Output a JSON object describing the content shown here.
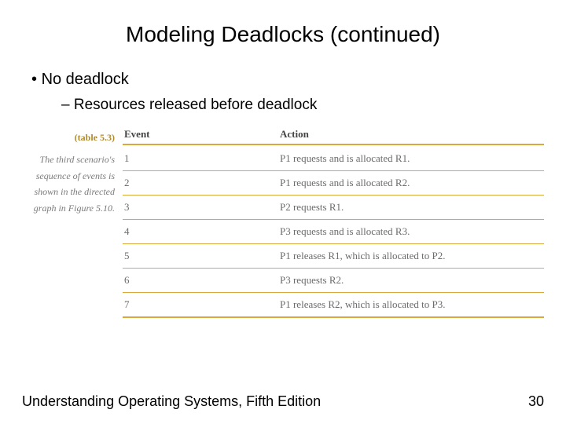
{
  "title": "Modeling Deadlocks (continued)",
  "bullets": {
    "b1": "No deadlock",
    "b2": "Resources released before deadlock"
  },
  "caption": {
    "label": "(table 5.3)",
    "text_l1": "The third scenario's",
    "text_l2": "sequence of events is",
    "text_l3": "shown in the directed",
    "text_l4": "graph in Figure 5.10."
  },
  "table": {
    "headers": {
      "event": "Event",
      "action": "Action"
    },
    "rows": [
      {
        "event": "1",
        "action": "P1 requests and is allocated R1."
      },
      {
        "event": "2",
        "action": "P1 requests and is allocated R2."
      },
      {
        "event": "3",
        "action": "P2 requests R1."
      },
      {
        "event": "4",
        "action": "P3 requests and is allocated R3."
      },
      {
        "event": "5",
        "action": "P1 releases R1, which is allocated to P2."
      },
      {
        "event": "6",
        "action": "P3 requests R2."
      },
      {
        "event": "7",
        "action": "P1 releases R2, which is allocated to P3."
      }
    ]
  },
  "footer": {
    "left": "Understanding Operating Systems, Fifth Edition",
    "right": "30"
  }
}
